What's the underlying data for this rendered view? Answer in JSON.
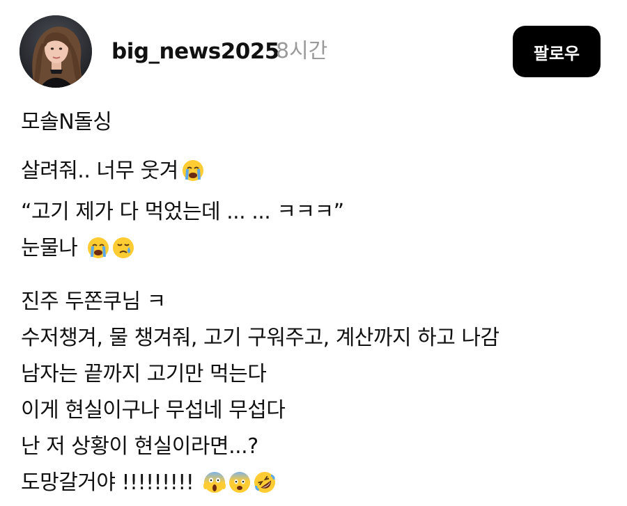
{
  "post": {
    "username": "big_news2025",
    "time": "8시간",
    "follow_label": "팔로우",
    "lines": {
      "title": "모솔N돌싱",
      "p1_l1": "살려줘.. 너무 웃겨",
      "p1_l2": "“고기 제가 다 먹었는데 ... ... ㅋㅋㅋ”",
      "p1_l3": "눈물나 ",
      "p2_l1": "진주 두쫀쿠님 ㅋ",
      "p2_l2": "수저챙겨, 물 챙겨줘, 고기 구워주고, 계산까지 하고 나감",
      "p2_l3": "남자는 끝까지 고기만 먹는다",
      "p2_l4": "이게 현실이구나 무섭네 무섭다",
      "p2_l5": "난 저 상황이 현실이라면...?",
      "p2_l6": "도망갈거야 !!!!!!!!! "
    },
    "emojis": {
      "line1": [
        "loudly-crying-face"
      ],
      "line3": [
        "loudly-crying-face",
        "face-holding-back-tears"
      ],
      "line9": [
        "face-screaming-in-fear",
        "anxious-face",
        "rolling-on-floor-laughing"
      ]
    }
  }
}
